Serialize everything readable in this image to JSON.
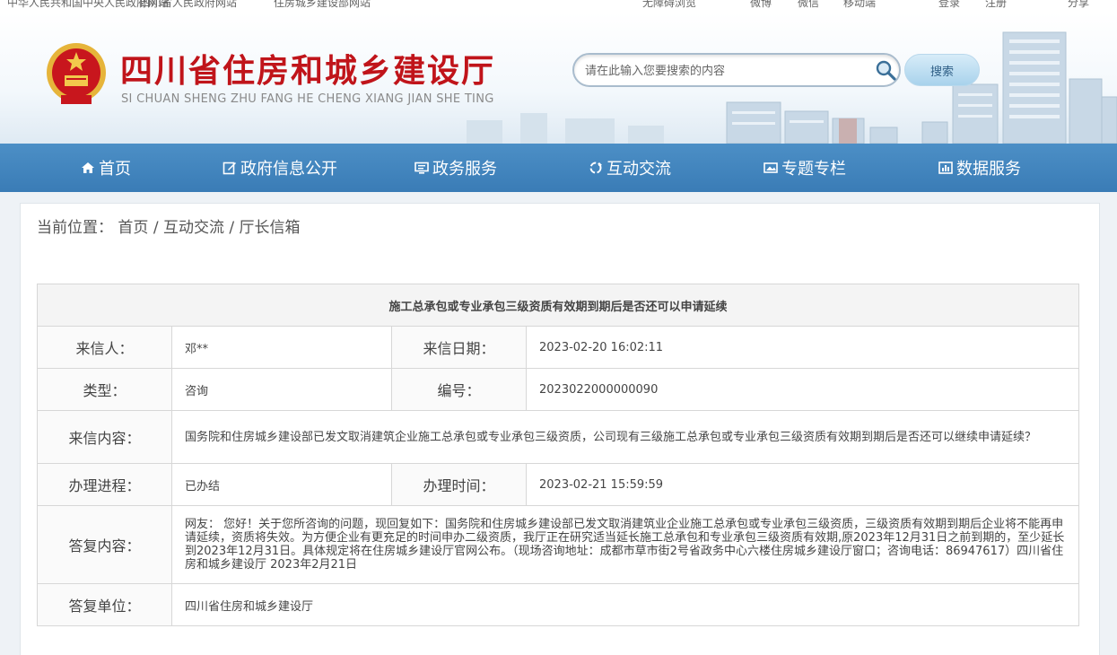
{
  "topbar": {
    "links": [
      "中华人民共和国中央人民政府网站",
      "四川省人民政府网站",
      "住房城乡建设部网站",
      "无障碍浏览",
      "微博",
      "微信",
      "移动端",
      "登录",
      "注册",
      "分享"
    ]
  },
  "header": {
    "title": "四川省住房和城乡建设厅",
    "subtitle": "SI CHUAN SHENG ZHU FANG HE CHENG XIANG JIAN SHE TING",
    "search_placeholder": "请在此输入您要搜索的内容",
    "search_button": "搜索"
  },
  "nav": {
    "items": [
      {
        "label": "首页",
        "icon": "home-icon"
      },
      {
        "label": "政府信息公开",
        "icon": "edit-icon"
      },
      {
        "label": "政务服务",
        "icon": "monitor-icon"
      },
      {
        "label": "互动交流",
        "icon": "recycle-icon"
      },
      {
        "label": "专题专栏",
        "icon": "image-icon"
      },
      {
        "label": "数据服务",
        "icon": "chart-icon"
      }
    ]
  },
  "breadcrumb": {
    "prefix": "当前位置：",
    "items": [
      "首页",
      "互动交流",
      "厅长信箱"
    ],
    "separator": "/"
  },
  "letter": {
    "title": "施工总承包或专业承包三级资质有效期到期后是否还可以申请延续",
    "sender_label": "来信人：",
    "sender": "邓**",
    "date_label": "来信日期：",
    "date": "2023-02-20 16:02:11",
    "type_label": "类型：",
    "type": "咨询",
    "number_label": "编号：",
    "number": "2023022000000090",
    "content_label": "来信内容：",
    "content": "国务院和住房城乡建设部已发文取消建筑企业施工总承包或专业承包三级资质，公司现有三级施工总承包或专业承包三级资质有效期到期后是否还可以继续申请延续？",
    "progress_label": "办理进程：",
    "progress": "已办结",
    "handle_time_label": "办理时间：",
    "handle_time": "2023-02-21 15:59:59",
    "reply_label": "答复内容：",
    "reply": "网友： 您好！关于您所咨询的问题，现回复如下：国务院和住房城乡建设部已发文取消建筑业企业施工总承包或专业承包三级资质，三级资质有效期到期后企业将不能再申请延续，资质将失效。为方便企业有更充足的时间申办二级资质，我厅正在研究适当延长施工总承包和专业承包三级资质有效期,原2023年12月31日之前到期的，至少延长到2023年12月31日。具体规定将在住房城乡建设厅官网公布。（现场咨询地址：成都市草市街2号省政务中心六楼住房城乡建设厅窗口；咨询电话：86947617）四川省住房和城乡建设厅 2023年2月21日",
    "unit_label": "答复单位：",
    "unit": "四川省住房和城乡建设厅"
  },
  "colors": {
    "nav_blue": "#3f82bc",
    "title_red": "#c0141a"
  }
}
